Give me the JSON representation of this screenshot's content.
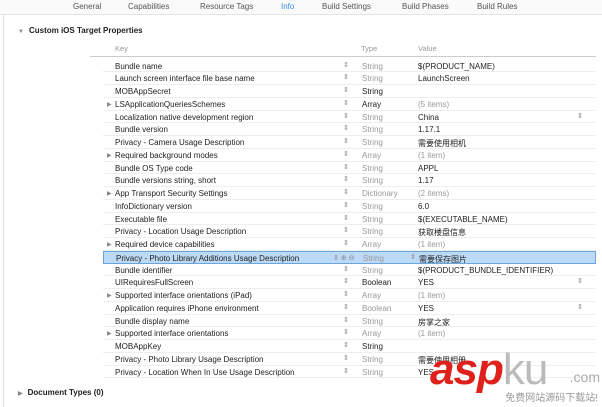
{
  "tabs": [
    "General",
    "Capabilities",
    "Resource Tags",
    "Info",
    "Build Settings",
    "Build Phases",
    "Build Rules"
  ],
  "active_tab": "Info",
  "section_title": "Custom iOS Target Properties",
  "columns": {
    "key": "Key",
    "type": "Type",
    "value": "Value"
  },
  "rows": [
    {
      "key": "Bundle name",
      "type": "String",
      "value": "$(PRODUCT_NAME)"
    },
    {
      "key": "Launch screen interface file base name",
      "type": "String",
      "value": "LaunchScreen"
    },
    {
      "key": "MOBAppSecret",
      "type": "String",
      "value": "",
      "type_dark": true
    },
    {
      "key": "LSApplicationQueriesSchemes",
      "type": "Array",
      "value": "(5 items)",
      "expand": true,
      "type_dark": true
    },
    {
      "key": "Localization native development region",
      "type": "String",
      "value": "China",
      "vstep": true
    },
    {
      "key": "Bundle version",
      "type": "String",
      "value": "1.17.1"
    },
    {
      "key": "Privacy - Camera Usage Description",
      "type": "String",
      "value": "需要使用相机"
    },
    {
      "key": "Required background modes",
      "type": "Array",
      "value": "(1 item)",
      "expand": true
    },
    {
      "key": "Bundle OS Type code",
      "type": "String",
      "value": "APPL"
    },
    {
      "key": "Bundle versions string, short",
      "type": "String",
      "value": "1.17"
    },
    {
      "key": "App Transport Security Settings",
      "type": "Dictionary",
      "value": "(2 items)",
      "expand": true
    },
    {
      "key": "InfoDictionary version",
      "type": "String",
      "value": "6.0"
    },
    {
      "key": "Executable file",
      "type": "String",
      "value": "$(EXECUTABLE_NAME)"
    },
    {
      "key": "Privacy - Location Usage Description",
      "type": "String",
      "value": "获取楼盘信息"
    },
    {
      "key": "Required device capabilities",
      "type": "Array",
      "value": "(1 item)",
      "expand": true
    },
    {
      "key": "Privacy - Photo Library Additions Usage Description",
      "type": "String",
      "value": "需要保存图片",
      "selected": true
    },
    {
      "key": "Bundle identifier",
      "type": "String",
      "value": "$(PRODUCT_BUNDLE_IDENTIFIER)"
    },
    {
      "key": "UIRequiresFullScreen",
      "type": "Boolean",
      "value": "YES",
      "vstep": true,
      "type_dark": true
    },
    {
      "key": "Supported interface orientations (iPad)",
      "type": "Array",
      "value": "(1 item)",
      "expand": true
    },
    {
      "key": "Application requires iPhone environment",
      "type": "Boolean",
      "value": "YES",
      "vstep": true
    },
    {
      "key": "Bundle display name",
      "type": "String",
      "value": "房掌之家"
    },
    {
      "key": "Supported interface orientations",
      "type": "Array",
      "value": "(1 item)",
      "expand": true
    },
    {
      "key": "MOBAppKey",
      "type": "String",
      "value": "",
      "type_dark": true
    },
    {
      "key": "Privacy - Photo Library Usage Description",
      "type": "String",
      "value": "需要使用相册"
    },
    {
      "key": "Privacy - Location When In Use Usage Description",
      "type": "String",
      "value": "YES"
    }
  ],
  "document_types": "Document Types (0)",
  "watermark": {
    "brand": "aspku",
    "tld": ".com",
    "slogan": "免费网站源码下载站!"
  }
}
